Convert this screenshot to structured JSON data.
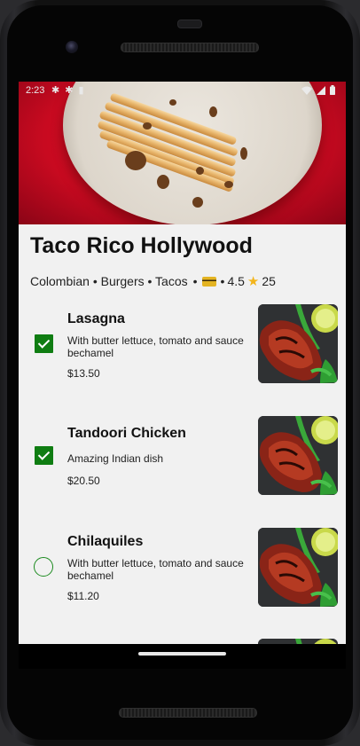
{
  "status_bar": {
    "time": "2:23"
  },
  "restaurant": {
    "name": "Taco Rico Hollywood",
    "categories": "Colombian • Burgers • Tacos",
    "separator": "•",
    "rating": "4.5",
    "review_count": "25"
  },
  "menu": {
    "items": [
      {
        "name": "Lasagna",
        "description": "With butter lettuce, tomato and sauce bechamel",
        "price": "$13.50",
        "selected": true
      },
      {
        "name": "Tandoori Chicken",
        "description": "Amazing Indian dish",
        "price": "$20.50",
        "selected": true
      },
      {
        "name": "Chilaquiles",
        "description": "With butter lettuce, tomato and sauce bechamel",
        "price": "$11.20",
        "selected": false
      }
    ]
  },
  "icons": {
    "payment": "credit-card-icon",
    "rating": "star-icon",
    "selected": "checkbox-checked-icon",
    "unselected": "radio-unchecked-icon"
  },
  "colors": {
    "accent_green": "#0f7d12",
    "hero_red": "#d40b24",
    "star": "#f3b51b"
  }
}
